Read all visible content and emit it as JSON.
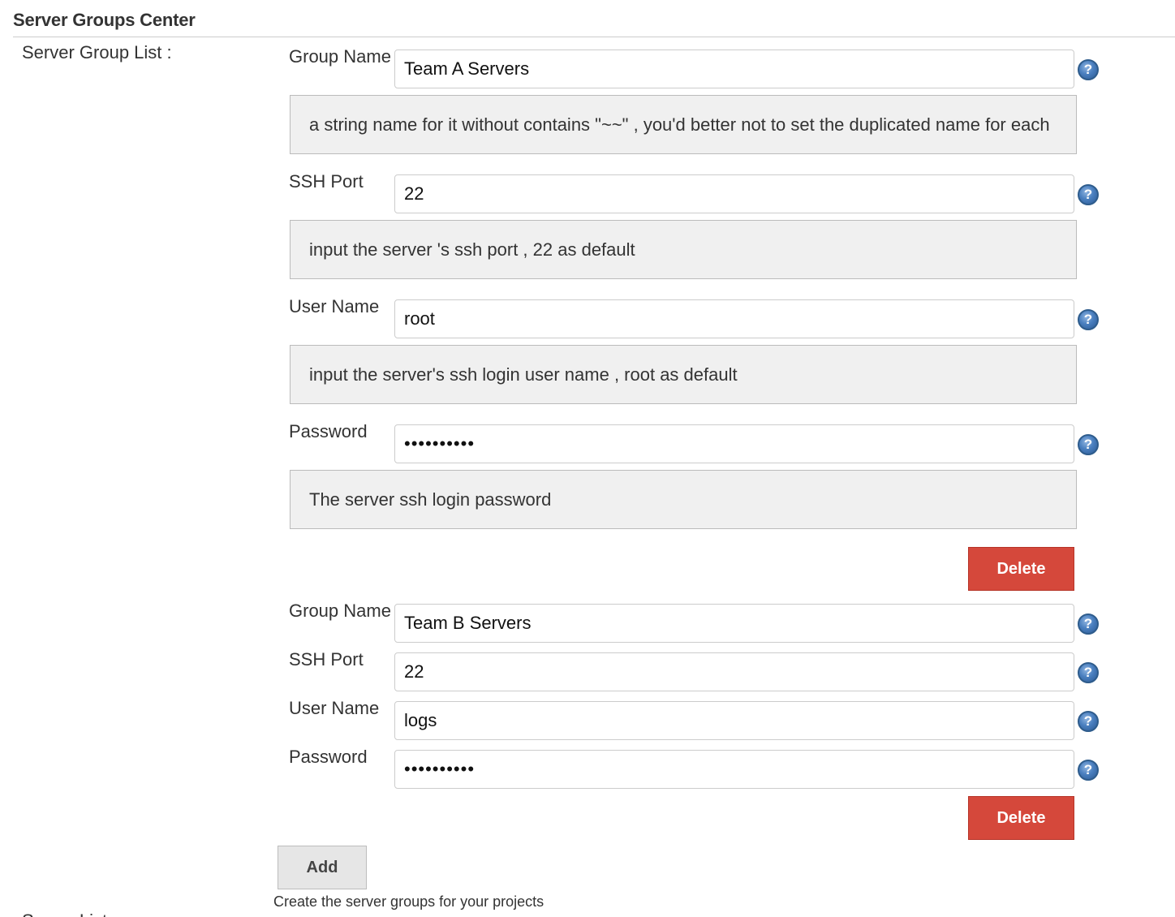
{
  "section": {
    "title": "Server Groups Center",
    "list_label": "Server Group List :"
  },
  "groups": [
    {
      "group_name_label": "Group Name",
      "group_name_value": "Team A Servers",
      "group_name_help": "a string name for it without contains \"~~\" , you'd better not to set the duplicated name for each",
      "ssh_port_label": "SSH Port",
      "ssh_port_value": "22",
      "ssh_port_help": "input the server 's ssh port , 22 as default",
      "user_name_label": "User Name",
      "user_name_value": "root",
      "user_name_help": "input the server's ssh login user name , root as default",
      "password_label": "Password",
      "password_value": "••••••••••",
      "password_help": "The server ssh login password",
      "delete_label": "Delete"
    },
    {
      "group_name_label": "Group Name",
      "group_name_value": "Team B Servers",
      "ssh_port_label": "SSH Port",
      "ssh_port_value": "22",
      "user_name_label": "User Name",
      "user_name_value": "logs",
      "password_label": "Password",
      "password_value": "••••••••••",
      "delete_label": "Delete"
    }
  ],
  "help_icon_glyph": "?",
  "add": {
    "label": "Add",
    "description": "Create the server groups for your projects"
  },
  "next_section_label": "Server List :",
  "colors": {
    "delete_button": "#d5483b",
    "help_box_bg": "#f0f0f0",
    "help_icon": "#4a7fbf"
  }
}
